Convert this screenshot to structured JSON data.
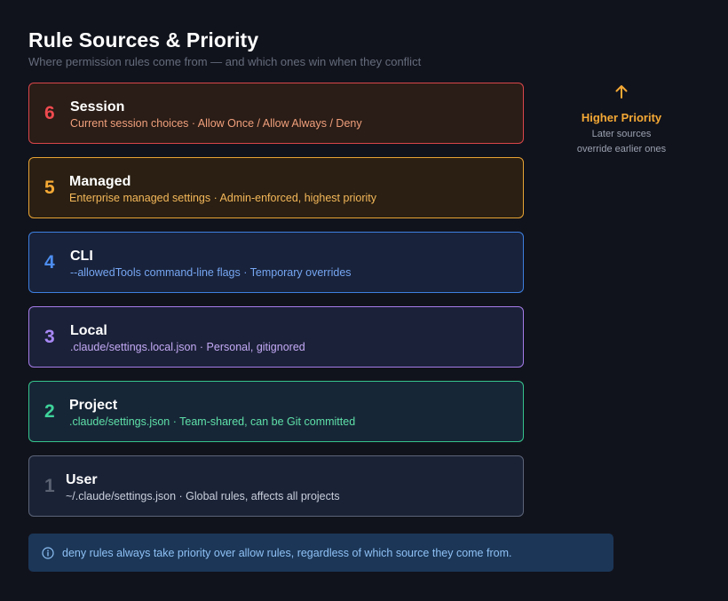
{
  "header": {
    "title": "Rule Sources & Priority",
    "subtitle": "Where permission rules come from — and which ones win when they conflict"
  },
  "sources": [
    {
      "number": "6",
      "name": "Session",
      "description": "Current session choices · Allow Once / Allow Always / Deny",
      "color": "#ef4a4f"
    },
    {
      "number": "5",
      "name": "Managed",
      "description": "Enterprise managed settings · Admin-enforced, highest priority",
      "color": "#f5a935"
    },
    {
      "number": "4",
      "name": "CLI",
      "description": "--allowedTools command-line flags · Temporary overrides",
      "color": "#4d8df0"
    },
    {
      "number": "3",
      "name": "Local",
      "description": ".claude/settings.local.json · Personal, gitignored",
      "color": "#a888f5"
    },
    {
      "number": "2",
      "name": "Project",
      "description": ".claude/settings.json · Team-shared, can be Git committed",
      "color": "#3ed39a"
    },
    {
      "number": "1",
      "name": "User",
      "description": "~/.claude/settings.json · Global rules, affects all projects",
      "color": "#5b6373"
    }
  ],
  "priority_indicator": {
    "icon": "arrow-up-icon",
    "label": "Higher Priority",
    "note_line1": "Later sources",
    "note_line2": "override earlier ones"
  },
  "info_banner": {
    "icon": "info-icon",
    "text": "deny rules always take priority over allow rules, regardless of which source they come from."
  }
}
